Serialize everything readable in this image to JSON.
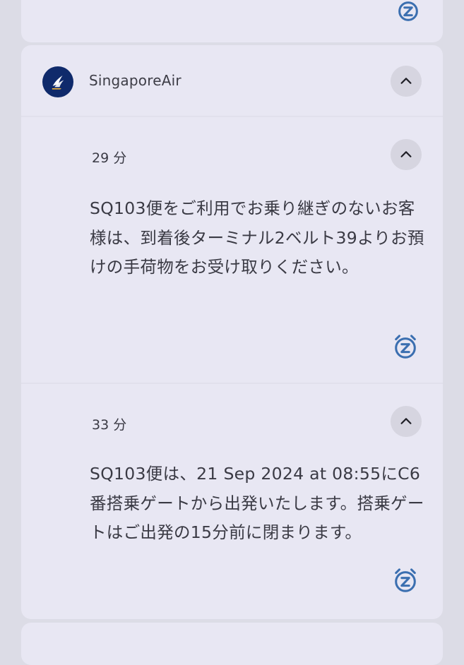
{
  "app": {
    "name": "SingaporeAir",
    "icon": "singapore-airlines-bird-logo-icon",
    "icon_bg": "#0f2a6b"
  },
  "notifications": [
    {
      "time": "29 分",
      "text": "SQ103便をご利用でお乗り継ぎのないお客様は、到着後ターミナル2ベルト39よりお預けの手荷物をお受け取りください。"
    },
    {
      "time": "33 分",
      "text": "SQ103便は、21 Sep 2024 at 08:55にC6番搭乗ゲートから出発いたします。搭乗ゲートはご出発の15分前に閉まります。"
    }
  ],
  "colors": {
    "background": "#dcdce6",
    "card": "#e8e7f3",
    "button_bg": "#d6d5e0",
    "snooze_icon": "#3b6fb0",
    "text": "#3a3a44"
  }
}
